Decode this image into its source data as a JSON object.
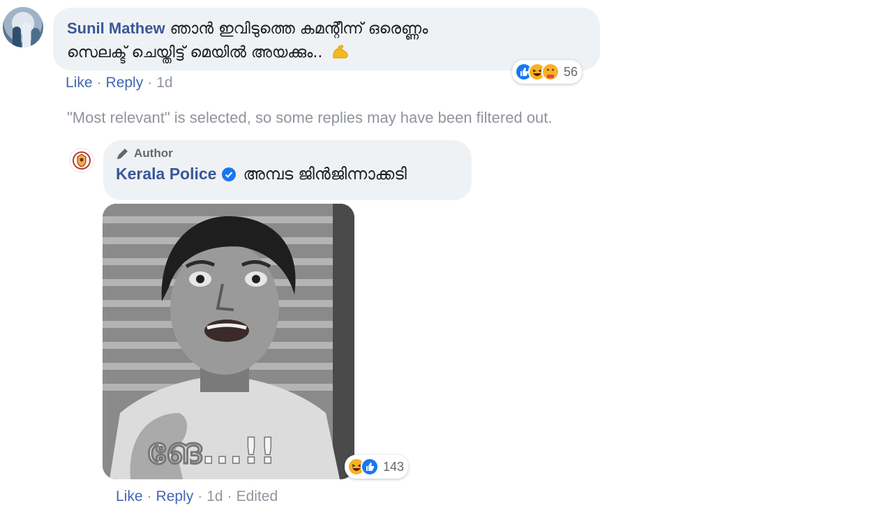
{
  "comment": {
    "author": "Sunil Mathew",
    "text_line1": "ഞാൻ ഇവിടുത്തെ കമന്റീന്ന് ഒരെണ്ണം",
    "text_line2": "സെലക്ട് ചെയ്തിട്ട് മെയിൽ അയക്കും..",
    "emoji_icon": "flexed-biceps-icon",
    "reactions": {
      "icons": [
        "like-icon",
        "haha-icon",
        "care-icon"
      ],
      "count": "56"
    },
    "actions": {
      "like": "Like",
      "reply": "Reply",
      "time": "1d"
    }
  },
  "filter_notice": "\"Most relevant\" is selected, so some replies may have been filtered out.",
  "reply": {
    "badge": "Author",
    "author": "Kerala Police",
    "text": "അമ്പട ജിൻജിന്നാക്കടി",
    "image_caption": "ങേ...!!",
    "reactions": {
      "icons": [
        "haha-icon",
        "like-icon"
      ],
      "count": "143"
    },
    "actions": {
      "like": "Like",
      "reply": "Reply",
      "time": "1d",
      "edited": "Edited"
    }
  },
  "colors": {
    "name_link": "#385898",
    "bubble_bg": "#eff2f5",
    "meta_gray": "#90949c",
    "like_blue": "#1877f2",
    "haha_yellow": "#f7b125"
  }
}
